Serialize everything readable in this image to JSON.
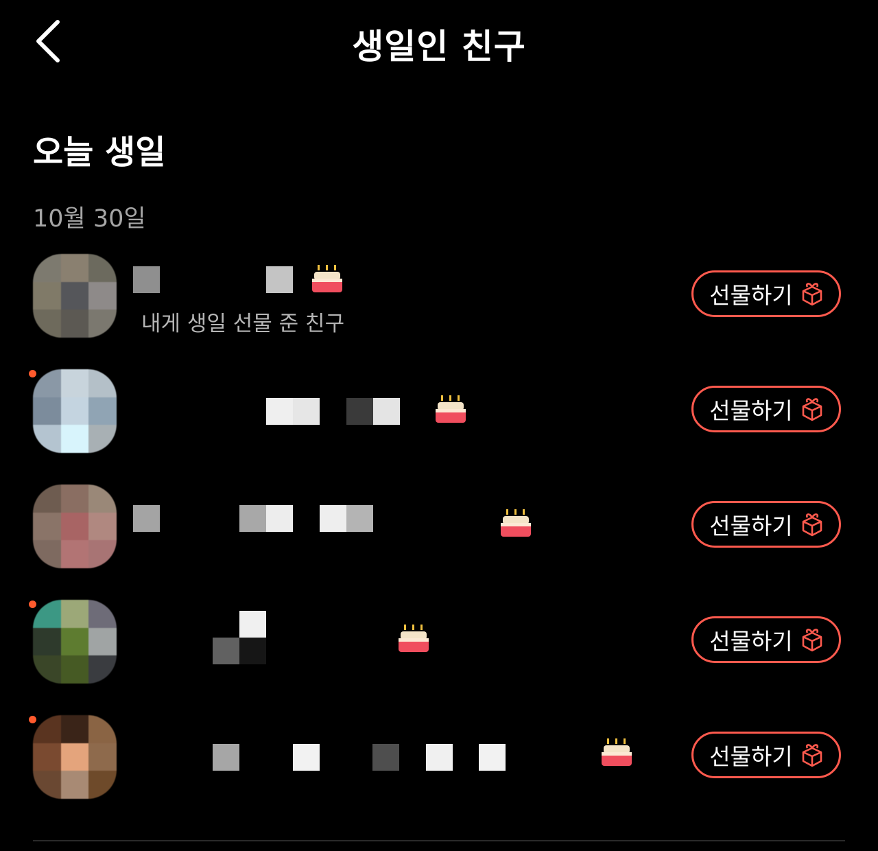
{
  "header": {
    "title": "생일인 친구",
    "back_icon": "chevron-left-icon"
  },
  "section": {
    "title": "오늘 생일",
    "date": "10월 30일"
  },
  "friends": [
    {
      "status": "내게 생일 선물 준 친구",
      "gift_label": "선물하기",
      "has_new_dot": false
    },
    {
      "status": "",
      "gift_label": "선물하기",
      "has_new_dot": true
    },
    {
      "status": "",
      "gift_label": "선물하기",
      "has_new_dot": false
    },
    {
      "status": "",
      "gift_label": "선물하기",
      "has_new_dot": true
    },
    {
      "status": "",
      "gift_label": "선물하기",
      "has_new_dot": true
    }
  ],
  "colors": {
    "background": "#000000",
    "accent": "#ff5a4e",
    "new_dot": "#ff5a2d",
    "secondary_text": "#a6a6a6"
  },
  "icons": {
    "birthday": "birthday-cake-icon",
    "gift": "gift-box-icon"
  }
}
